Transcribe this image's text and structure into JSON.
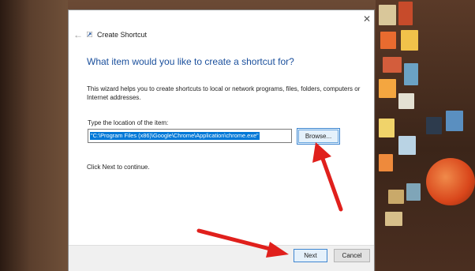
{
  "window": {
    "title": "Create Shortcut",
    "close_symbol": "✕",
    "back_symbol": "←"
  },
  "wizard": {
    "heading": "What item would you like to create a shortcut for?",
    "description": "This wizard helps you to create shortcuts to local or network programs, files, folders, computers or Internet addresses.",
    "location_label": "Type the location of the item:",
    "location_value": "\"C:\\Program Files (x86)\\Google\\Chrome\\Application\\chrome.exe\"",
    "browse_label": "Browse...",
    "continue_text": "Click Next to continue."
  },
  "footer": {
    "next_label": "Next",
    "cancel_label": "Cancel"
  },
  "colors": {
    "heading": "#1a4f9c",
    "selection": "#0078d7",
    "arrow": "#e0201c"
  },
  "icons": [
    "back-arrow-icon",
    "shortcut-icon",
    "close-icon"
  ]
}
